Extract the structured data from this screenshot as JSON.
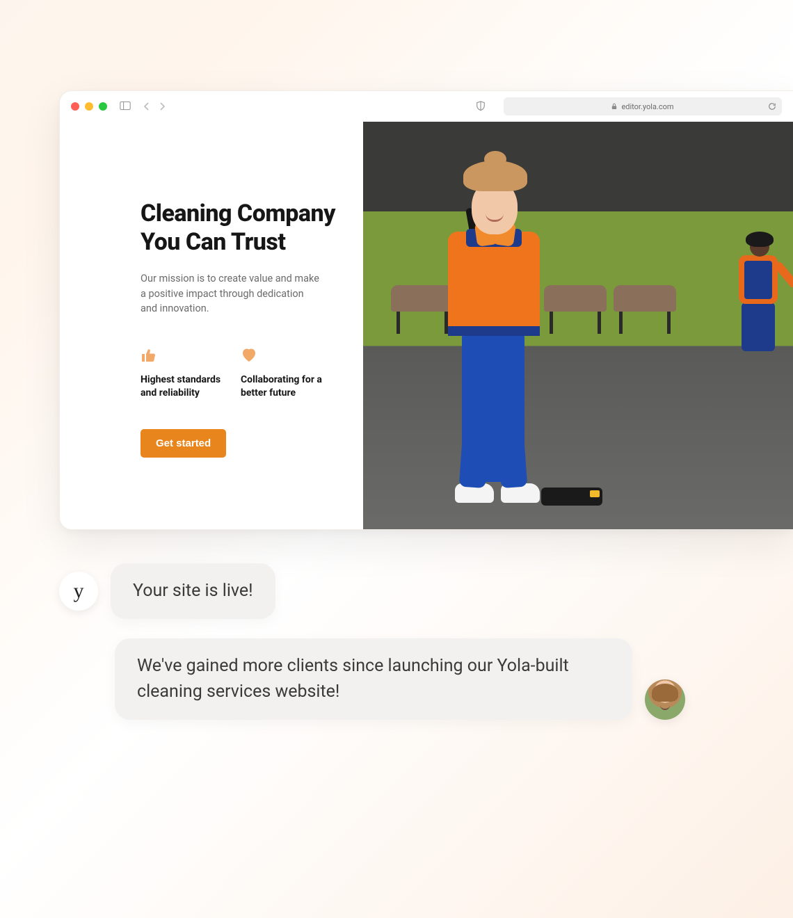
{
  "browser": {
    "url": "editor.yola.com"
  },
  "hero": {
    "title": "Cleaning Company You Can Trust",
    "subtitle": "Our mission is to create value and make a positive impact through dedication and innovation.",
    "features": [
      {
        "label": "Highest standards and reliability"
      },
      {
        "label": "Collaborating for a better future"
      }
    ],
    "cta": "Get started"
  },
  "chat": {
    "brand_glyph": "y",
    "message1": "Your site is live!",
    "message2": "We've gained more clients since launching our Yola-built cleaning services website!"
  },
  "colors": {
    "accent": "#e8851c",
    "feature_icon": "#f2a968"
  }
}
